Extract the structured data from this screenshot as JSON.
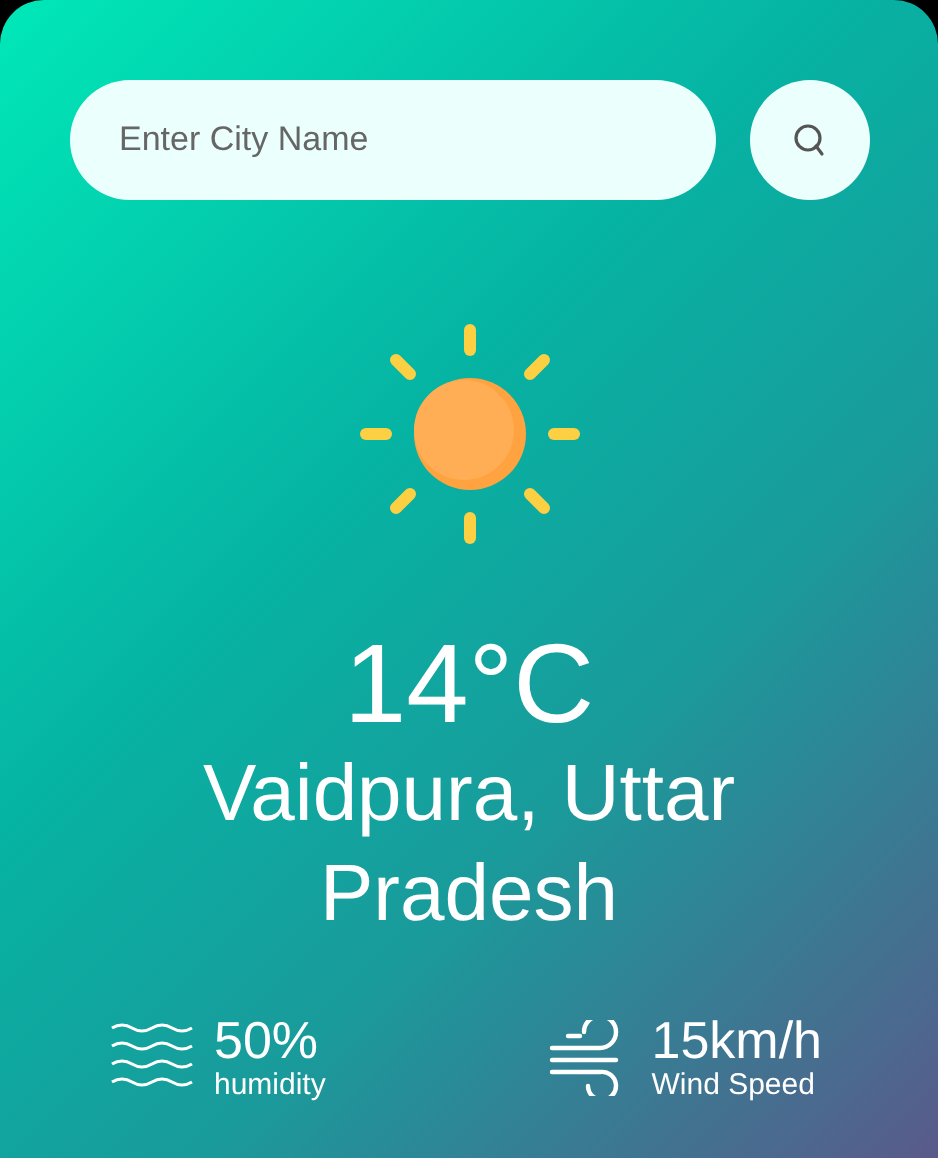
{
  "search": {
    "placeholder": "Enter City Name"
  },
  "weather": {
    "temperature": "14°C",
    "city": "Vaidpura, Uttar Pradesh"
  },
  "details": [
    {
      "kind": "humidity",
      "value": "50%",
      "label": "humidity"
    },
    {
      "kind": "wind",
      "value": "15km/h",
      "label": "Wind Speed"
    }
  ]
}
